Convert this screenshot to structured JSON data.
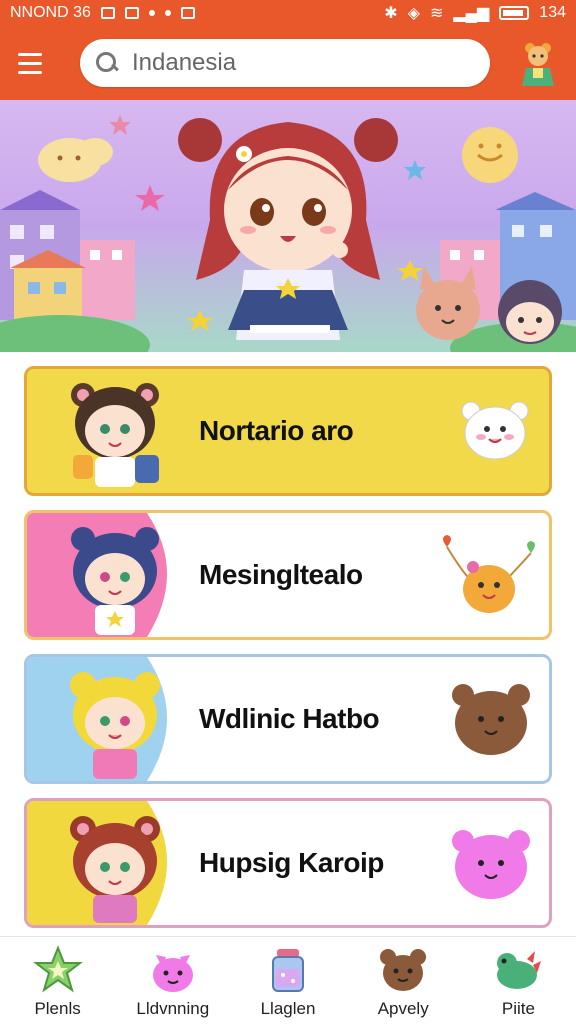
{
  "status_bar": {
    "left_text": "NNOND 36",
    "right_text": "134"
  },
  "search": {
    "value": "Indanesia"
  },
  "cards": [
    {
      "label": "Nortario aro",
      "bg": "#f1d94a",
      "border": "#e4a83a"
    },
    {
      "label": "Mesingltealo",
      "bg": "#f47db6",
      "border": "#f0c36a"
    },
    {
      "label": "Wdlinic Hatbo",
      "bg": "#9fd2ef",
      "border": "#a6c6e6"
    },
    {
      "label": "Hupsig Karoip",
      "bg": "#f0d83e",
      "border": "#e0a0c0"
    }
  ],
  "bottom_nav": [
    {
      "label": "Plenls",
      "icon": "star-icon"
    },
    {
      "label": "Lldvnning",
      "icon": "pink-cat-icon"
    },
    {
      "label": "Llaglen",
      "icon": "jar-icon"
    },
    {
      "label": "Apvely",
      "icon": "bear-icon"
    },
    {
      "label": "Piite",
      "icon": "dino-icon"
    }
  ],
  "colors": {
    "accent": "#e8582a",
    "status_bar": "#e8582a"
  }
}
